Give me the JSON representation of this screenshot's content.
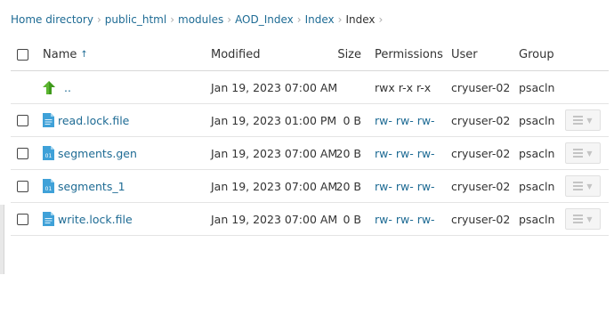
{
  "breadcrumb": [
    "Home directory",
    "public_html",
    "modules",
    "AOD_Index",
    "Index",
    "Index"
  ],
  "columns": {
    "name": "Name",
    "name_sort": "↑",
    "modified": "Modified",
    "size": "Size",
    "permissions": "Permissions",
    "user": "User",
    "group": "Group"
  },
  "parent_row": {
    "name": "..",
    "modified": "Jan 19, 2023 07:00 AM",
    "permissions": "rwx r-x r-x",
    "user": "cryuser-02",
    "group": "psacln"
  },
  "files": [
    {
      "name": "read.lock.file",
      "modified": "Jan 19, 2023 01:00 PM",
      "size": "0 B",
      "permissions": "rw- rw- rw-",
      "user": "cryuser-02",
      "group": "psacln",
      "icon": "text-file-icon"
    },
    {
      "name": "segments.gen",
      "modified": "Jan 19, 2023 07:00 AM",
      "size": "20 B",
      "permissions": "rw- rw- rw-",
      "user": "cryuser-02",
      "group": "psacln",
      "icon": "binary-file-icon"
    },
    {
      "name": "segments_1",
      "modified": "Jan 19, 2023 07:00 AM",
      "size": "20 B",
      "permissions": "rw- rw- rw-",
      "user": "cryuser-02",
      "group": "psacln",
      "icon": "binary-file-icon"
    },
    {
      "name": "write.lock.file",
      "modified": "Jan 19, 2023 07:00 AM",
      "size": "0 B",
      "permissions": "rw- rw- rw-",
      "user": "cryuser-02",
      "group": "psacln",
      "icon": "text-file-icon"
    }
  ],
  "colors": {
    "link": "#1e6b94",
    "text": "#333333",
    "up_arrow": "#5cb531",
    "file_icon": "#3fa1d8"
  }
}
